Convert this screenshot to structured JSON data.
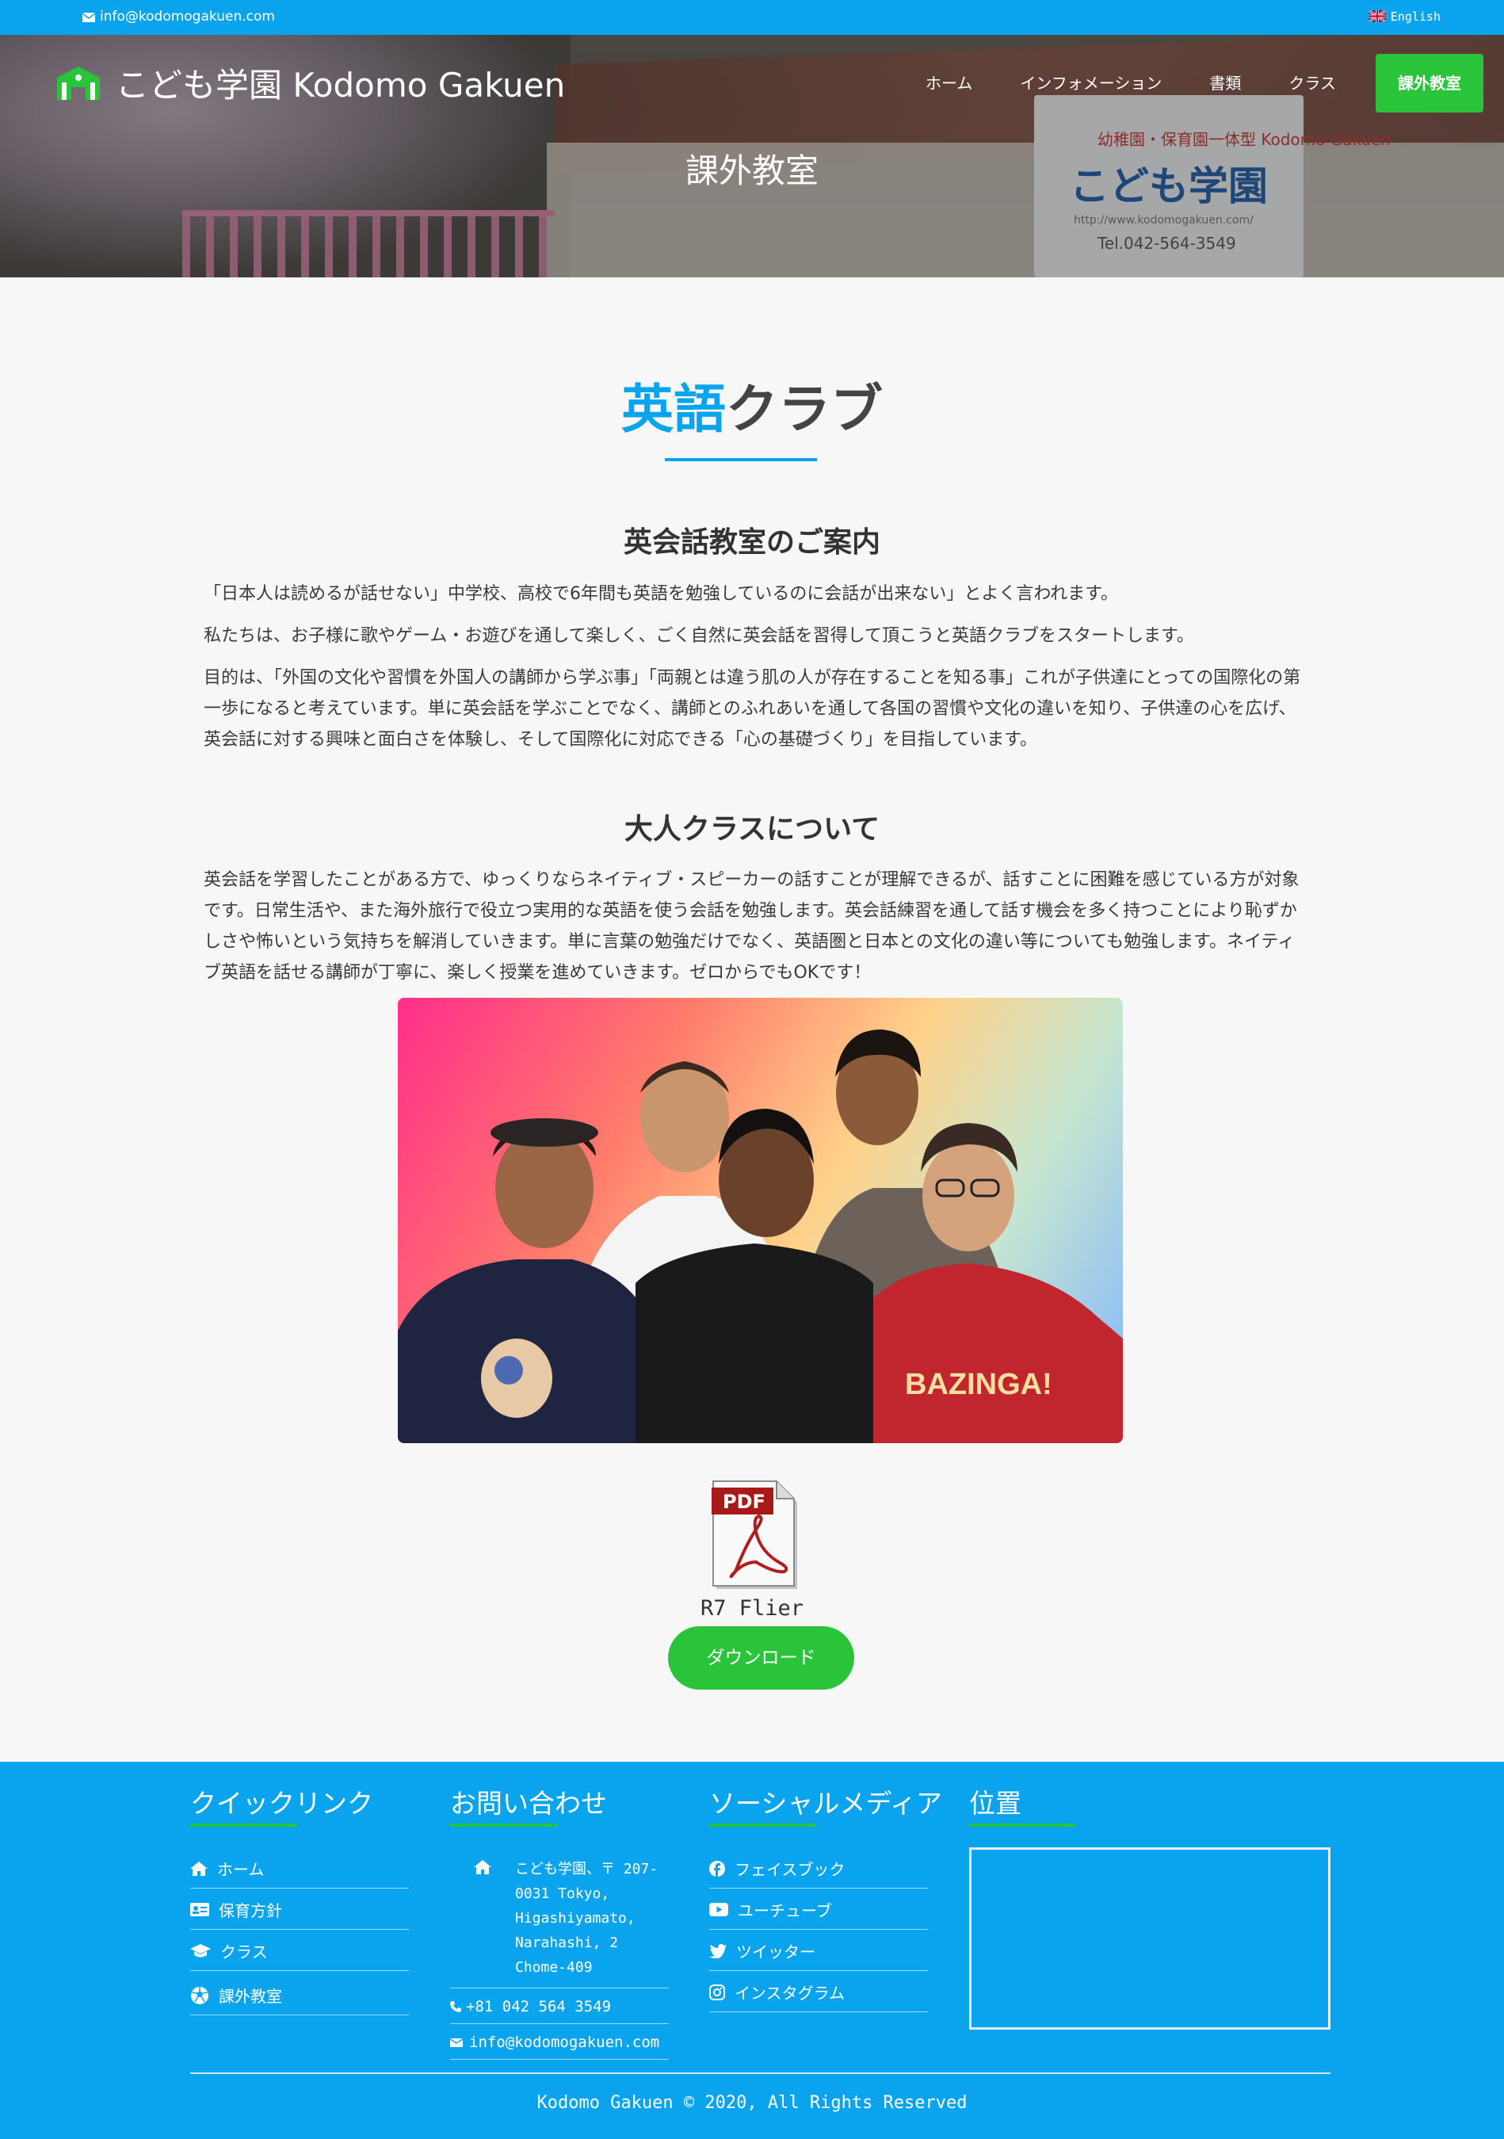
{
  "topbar": {
    "email": "info@kodomogakuen.com",
    "language": "English"
  },
  "brand": {
    "name": "こども学園 Kodomo Gakuen"
  },
  "nav": {
    "items": [
      "ホーム",
      "インフォメーション",
      "書類",
      "クラス",
      "課外教室"
    ],
    "active_index": 4
  },
  "hero": {
    "page_title": "課外教室",
    "sign_small": "幼稚園・保育園一体型 Kodomo Gakuen",
    "sign_main": "こども学園",
    "sign_url": "http://www.kodomogakuen.com/",
    "sign_tel": "Tel.042-564-3549"
  },
  "main": {
    "heading_accent": "英語",
    "heading_rest": "クラブ",
    "section1_title": "英会話教室のご案内",
    "section1_paragraphs": [
      "「日本人は読めるが話せない」中学校、高校で6年間も英語を勉強しているのに会話が出来ない」とよく言われます。",
      "私たちは、お子様に歌やゲーム・お遊びを通して楽しく、ごく自然に英会話を習得して頂こうと英語クラブをスタートします。",
      "目的は、「外国の文化や習慣を外国人の講師から学ぶ事」「両親とは違う肌の人が存在することを知る事」これが子供達にとっての国際化の第一歩になると考えています。単に英会話を学ぶことでなく、講師とのふれあいを通して各国の習慣や文化の違いを知り、子供達の心を広げ、英会話に対する興味と面白さを体験し、そして国際化に対応できる「心の基礎づくり」を目指しています。"
    ],
    "section2_title": "大人クラスについて",
    "section2_paragraph": "英会話を学習したことがある方で、ゆっくりならネイティブ・スピーカーの話すことが理解できるが、話すことに困難を感じている方が対象です。日常生活や、また海外旅行で役立つ実用的な英語を使う会話を勉強します。英会話練習を通して話す機会を多く持つことにより恥ずかしさや怖いという気持ちを解消していきます。単に言葉の勉強だけでなく、英語圏と日本との文化の違い等についても勉強します。ネイティブ英語を話せる講師が丁寧に、楽しく授業を進めていきます。ゼロからでもOKです！",
    "pdf_label": "PDF",
    "pdf_caption": "R7 Flier",
    "download_label": "ダウンロード"
  },
  "footer": {
    "quick_links": {
      "title": "クイックリンク",
      "items": [
        "ホーム",
        "保育方針",
        "クラス",
        "課外教室"
      ]
    },
    "contact": {
      "title": "お問い合わせ",
      "address": "こども学園、〒 207-0031 Tokyo, Higashiyamato, Narahashi, 2 Chome-409",
      "phone": "+81 042 564 3549",
      "email": "info@kodomogakuen.com"
    },
    "social": {
      "title": "ソーシャルメディア",
      "items": [
        "フェイスブック",
        "ユーチューブ",
        "ツイッター",
        "インスタグラム"
      ]
    },
    "location": {
      "title": "位置"
    },
    "copyright": "Kodomo Gakuen © 2020, All Rights Reserved"
  },
  "colors": {
    "primary": "#0aa4ee",
    "accent_green": "#2ac43b"
  }
}
